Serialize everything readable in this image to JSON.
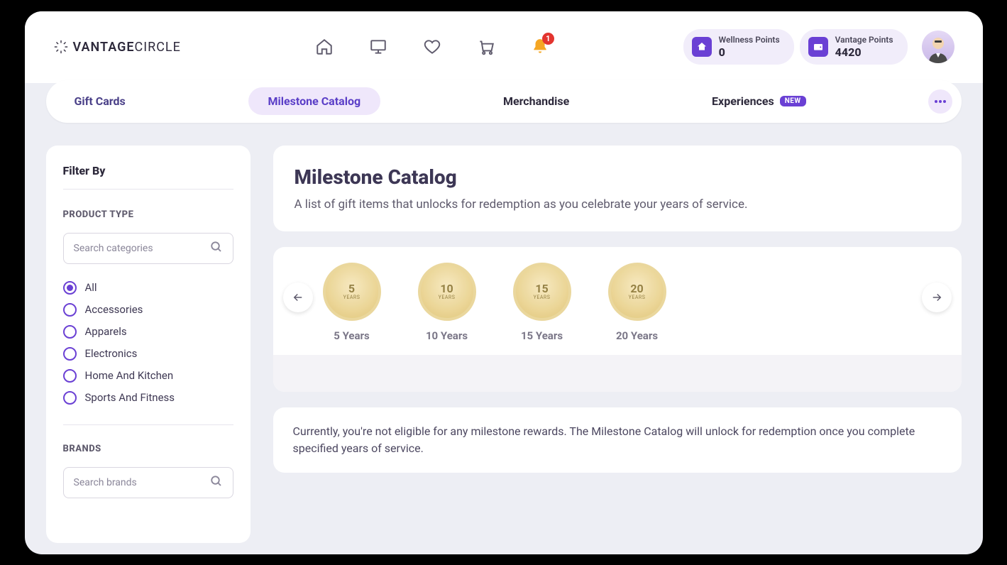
{
  "brand": {
    "name": "VANTAGE",
    "suffix": "CIRCLE"
  },
  "header": {
    "notification_count": "1",
    "wellness": {
      "label": "Wellness Points",
      "value": "0"
    },
    "vantage": {
      "label": "Vantage Points",
      "value": "4420"
    }
  },
  "tabs": {
    "gift_cards": "Gift Cards",
    "milestone": "Milestone Catalog",
    "merchandise": "Merchandise",
    "experiences": "Experiences",
    "new_badge": "NEW"
  },
  "sidebar": {
    "filter_by": "Filter By",
    "product_type": "PRODUCT TYPE",
    "search_categories_ph": "Search categories",
    "brands": "BRANDS",
    "search_brands_ph": "Search brands",
    "categories": [
      {
        "label": "All",
        "selected": true
      },
      {
        "label": "Accessories",
        "selected": false
      },
      {
        "label": "Apparels",
        "selected": false
      },
      {
        "label": "Electronics",
        "selected": false
      },
      {
        "label": "Home And Kitchen",
        "selected": false
      },
      {
        "label": "Sports And Fitness",
        "selected": false
      }
    ]
  },
  "main": {
    "title": "Milestone Catalog",
    "description": "A list of gift items that unlocks for redemption as you celebrate your years of service.",
    "milestones": [
      {
        "num": "5",
        "label": "5 Years"
      },
      {
        "num": "10",
        "label": "10 Years"
      },
      {
        "num": "15",
        "label": "15 Years"
      },
      {
        "num": "20",
        "label": "20 Years"
      }
    ],
    "notice": "Currently, you're not eligible for any milestone rewards. The Milestone Catalog will unlock for redemption once you complete specified years of service."
  }
}
